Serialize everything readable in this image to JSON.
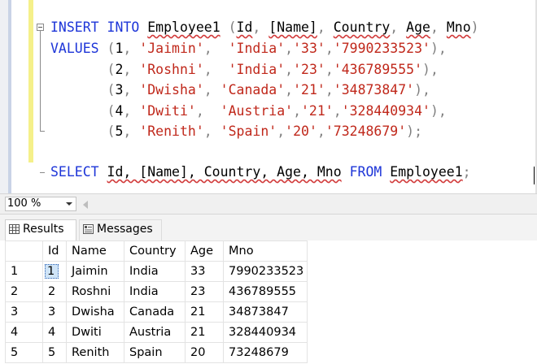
{
  "editor": {
    "insert_line": {
      "kw1": "INSERT",
      "kw2": "INTO",
      "table": "Employee1",
      "rest_open": " (",
      "cols": [
        "Id",
        "[Name]",
        "Country",
        "Age",
        "Mno"
      ],
      "close": ")"
    },
    "values_kw": "VALUES",
    "value_rows": [
      {
        "id": "1",
        "name": "'Jaimin'",
        "pad": ",  ",
        "country": "'India'",
        "age": "'33'",
        "mno": "'7990233523'",
        "end": "),"
      },
      {
        "id": "2",
        "name": "'Roshni'",
        "pad": ",  ",
        "country": "'India'",
        "age": "'23'",
        "mno": "'436789555'",
        "end": "),"
      },
      {
        "id": "3",
        "name": "'Dwisha'",
        "pad": ", ",
        "country": "'Canada'",
        "age": "'21'",
        "mno": "'34873847'",
        "end": "),"
      },
      {
        "id": "4",
        "name": "'Dwiti'",
        "pad": ",  ",
        "country": "'Austria'",
        "age": "'21'",
        "mno": "'328440934'",
        "end": "),"
      },
      {
        "id": "5",
        "name": "'Renith'",
        "pad": ", ",
        "country": "'Spain'",
        "age": "'20'",
        "mno": "'73248679'",
        "end": ");"
      }
    ],
    "select_line": {
      "kw1": "SELECT",
      "cols": "Id, [Name], Country, Age, Mno",
      "kw2": "FROM",
      "table": "Employee1",
      "end": ";"
    }
  },
  "status": {
    "zoom": "100 %"
  },
  "tabs": {
    "results": "Results",
    "messages": "Messages"
  },
  "grid": {
    "headers": [
      "Id",
      "Name",
      "Country",
      "Age",
      "Mno"
    ],
    "rows": [
      {
        "num": "1",
        "cells": [
          "1",
          "Jaimin",
          "India",
          "33",
          "7990233523"
        ]
      },
      {
        "num": "2",
        "cells": [
          "2",
          "Roshni",
          "India",
          "23",
          "436789555"
        ]
      },
      {
        "num": "3",
        "cells": [
          "3",
          "Dwisha",
          "Canada",
          "21",
          "34873847"
        ]
      },
      {
        "num": "4",
        "cells": [
          "4",
          "Dwiti",
          "Austria",
          "21",
          "328440934"
        ]
      },
      {
        "num": "5",
        "cells": [
          "5",
          "Renith",
          "Spain",
          "20",
          "73248679"
        ]
      }
    ]
  },
  "icons": {
    "results": "grid-icon",
    "messages": "messages-icon"
  }
}
